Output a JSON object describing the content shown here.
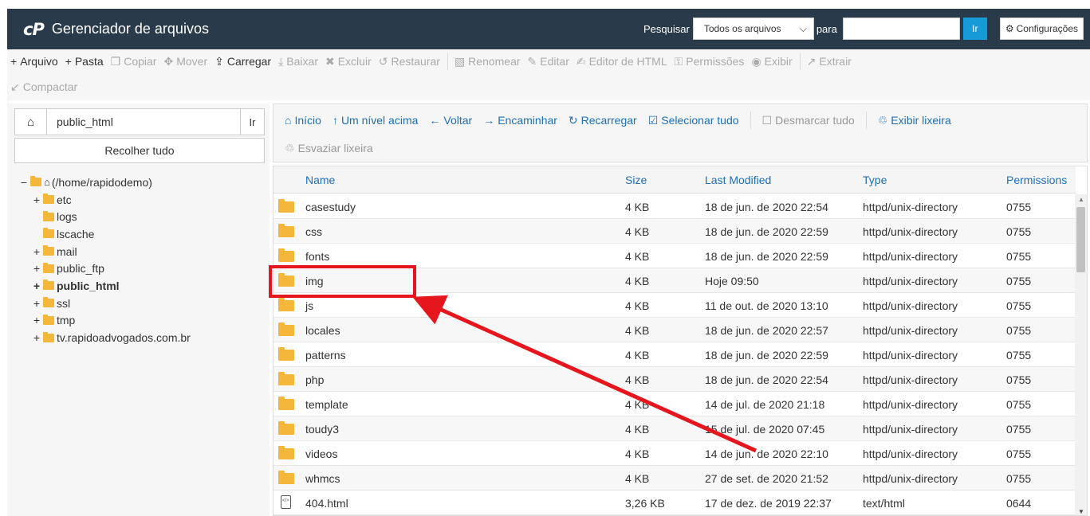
{
  "header": {
    "logo": "cP",
    "title": "Gerenciador de arquivos",
    "search_label": "Pesquisar",
    "search_select": "Todos os arquivos",
    "for_label": "para",
    "search_value": "",
    "go_label": "Ir",
    "settings_label": "Configurações"
  },
  "toolbar": {
    "row1": [
      {
        "label": "Arquivo",
        "icon": "plus-icon",
        "enabled": true
      },
      {
        "label": "Pasta",
        "icon": "plus-icon",
        "enabled": true
      },
      {
        "label": "Copiar",
        "icon": "copy-icon",
        "enabled": false
      },
      {
        "label": "Mover",
        "icon": "move-icon",
        "enabled": false
      },
      {
        "label": "Carregar",
        "icon": "upload-icon",
        "enabled": true
      },
      {
        "label": "Baixar",
        "icon": "download-icon",
        "enabled": false
      },
      {
        "label": "Excluir",
        "icon": "delete-icon",
        "enabled": false
      },
      {
        "label": "Restaurar",
        "icon": "restore-icon",
        "enabled": false
      },
      {
        "label": "Renomear",
        "icon": "rename-icon",
        "enabled": false
      },
      {
        "label": "Editar",
        "icon": "pencil-icon",
        "enabled": false
      },
      {
        "label": "Editor de HTML",
        "icon": "html-editor-icon",
        "enabled": false
      },
      {
        "label": "Permissões",
        "icon": "key-icon",
        "enabled": false
      },
      {
        "label": "Exibir",
        "icon": "eye-icon",
        "enabled": false
      },
      {
        "label": "Extrair",
        "icon": "extract-icon",
        "enabled": false
      }
    ],
    "row2": [
      {
        "label": "Compactar",
        "icon": "compress-icon",
        "enabled": false
      }
    ]
  },
  "left": {
    "path_value": "public_html",
    "go_label": "Ir",
    "collapse_label": "Recolher tudo",
    "tree": [
      {
        "toggle": "−",
        "label": "(/home/rapidodemo)",
        "level": 0,
        "home": true,
        "bold": false
      },
      {
        "toggle": "+",
        "label": "etc",
        "level": 1,
        "bold": false
      },
      {
        "toggle": "",
        "label": "logs",
        "level": 1,
        "bold": false
      },
      {
        "toggle": "",
        "label": "lscache",
        "level": 1,
        "bold": false
      },
      {
        "toggle": "+",
        "label": "mail",
        "level": 1,
        "bold": false
      },
      {
        "toggle": "+",
        "label": "public_ftp",
        "level": 1,
        "bold": false
      },
      {
        "toggle": "+",
        "label": "public_html",
        "level": 1,
        "bold": true
      },
      {
        "toggle": "+",
        "label": "ssl",
        "level": 1,
        "bold": false
      },
      {
        "toggle": "+",
        "label": "tmp",
        "level": 1,
        "bold": false
      },
      {
        "toggle": "+",
        "label": "tv.rapidoadvogados.com.br",
        "level": 1,
        "bold": false
      }
    ]
  },
  "nav": {
    "row1": [
      {
        "label": "Início",
        "icon": "home-icon"
      },
      {
        "label": "Um nível acima",
        "icon": "level-up-icon"
      },
      {
        "label": "Voltar",
        "icon": "arrow-left-icon"
      },
      {
        "label": "Encaminhar",
        "icon": "arrow-right-icon"
      },
      {
        "label": "Recarregar",
        "icon": "refresh-icon"
      },
      {
        "label": "Selecionar tudo",
        "icon": "checkbox-checked-icon"
      },
      {
        "label": "Desmarcar tudo",
        "icon": "checkbox-empty-icon",
        "disabled": true
      },
      {
        "label": "Exibir lixeira",
        "icon": "trash-icon"
      }
    ],
    "row2": [
      {
        "label": "Esvaziar lixeira",
        "icon": "trash-icon",
        "disabled": true
      }
    ]
  },
  "table": {
    "columns": [
      "Name",
      "Size",
      "Last Modified",
      "Type",
      "Permissions"
    ],
    "rows": [
      {
        "name": "casestudy",
        "size": "4 KB",
        "modified": "18 de jun. de 2020 22:54",
        "type": "httpd/unix-directory",
        "perms": "0755",
        "kind": "folder"
      },
      {
        "name": "css",
        "size": "4 KB",
        "modified": "18 de jun. de 2020 22:59",
        "type": "httpd/unix-directory",
        "perms": "0755",
        "kind": "folder"
      },
      {
        "name": "fonts",
        "size": "4 KB",
        "modified": "18 de jun. de 2020 22:59",
        "type": "httpd/unix-directory",
        "perms": "0755",
        "kind": "folder"
      },
      {
        "name": "img",
        "size": "4 KB",
        "modified": "Hoje 09:50",
        "type": "httpd/unix-directory",
        "perms": "0755",
        "kind": "folder"
      },
      {
        "name": "js",
        "size": "4 KB",
        "modified": "11 de out. de 2020 13:10",
        "type": "httpd/unix-directory",
        "perms": "0755",
        "kind": "folder"
      },
      {
        "name": "locales",
        "size": "4 KB",
        "modified": "18 de jun. de 2020 22:57",
        "type": "httpd/unix-directory",
        "perms": "0755",
        "kind": "folder"
      },
      {
        "name": "patterns",
        "size": "4 KB",
        "modified": "18 de jun. de 2020 22:59",
        "type": "httpd/unix-directory",
        "perms": "0755",
        "kind": "folder"
      },
      {
        "name": "php",
        "size": "4 KB",
        "modified": "18 de jun. de 2020 22:54",
        "type": "httpd/unix-directory",
        "perms": "0755",
        "kind": "folder"
      },
      {
        "name": "template",
        "size": "4 KB",
        "modified": "14 de jul. de 2020 21:18",
        "type": "httpd/unix-directory",
        "perms": "0755",
        "kind": "folder"
      },
      {
        "name": "toudy3",
        "size": "4 KB",
        "modified": "15 de jul. de 2020 07:45",
        "type": "httpd/unix-directory",
        "perms": "0755",
        "kind": "folder"
      },
      {
        "name": "videos",
        "size": "4 KB",
        "modified": "14 de jun. de 2020 22:10",
        "type": "httpd/unix-directory",
        "perms": "0755",
        "kind": "folder"
      },
      {
        "name": "whmcs",
        "size": "4 KB",
        "modified": "27 de set. de 2020 21:52",
        "type": "httpd/unix-directory",
        "perms": "0755",
        "kind": "folder"
      },
      {
        "name": "404.html",
        "size": "3,26 KB",
        "modified": "17 de dez. de 2019 22:37",
        "type": "text/html",
        "perms": "0644",
        "kind": "html"
      }
    ]
  },
  "colors": {
    "header_bg": "#293a4a",
    "accent_blue": "#179bd7",
    "link_blue": "#1d6fb8",
    "folder": "#f4b73a",
    "annotation_red": "#e5161d"
  }
}
